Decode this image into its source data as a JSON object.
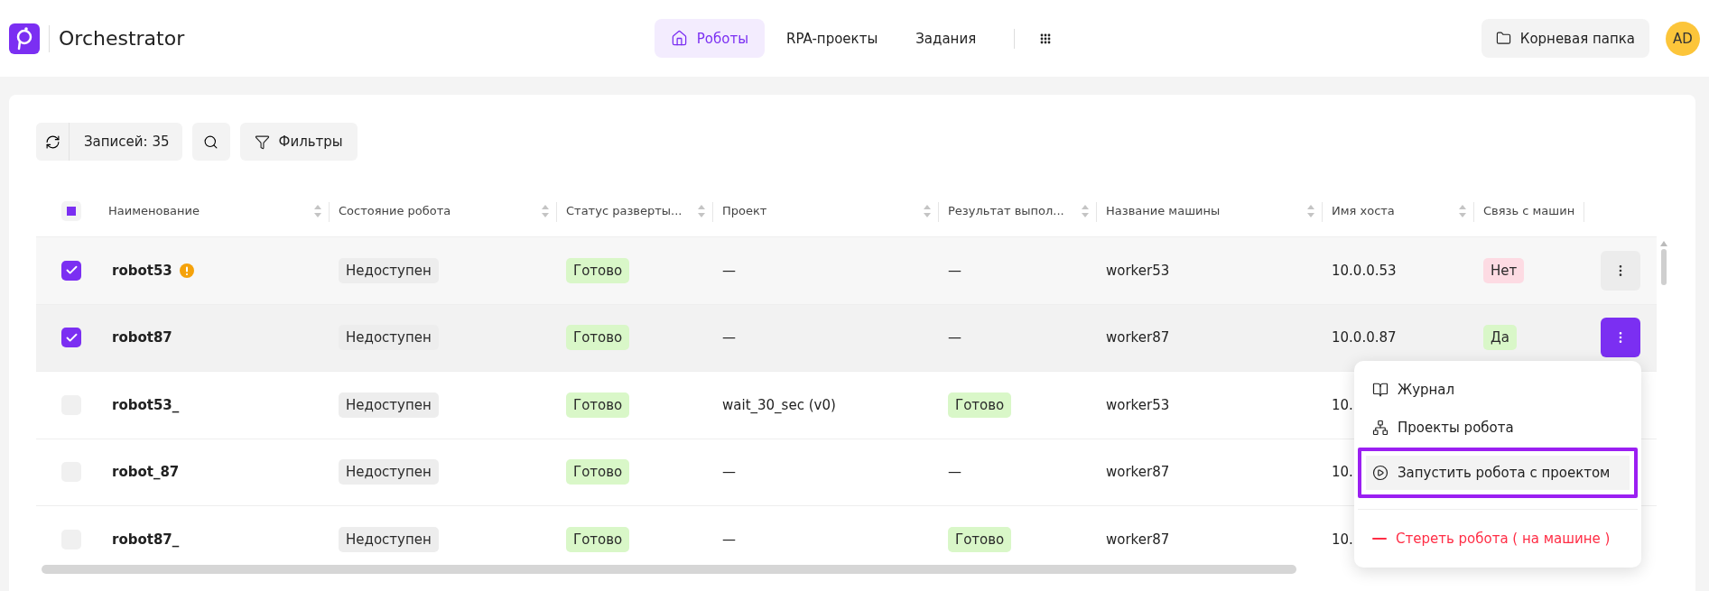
{
  "app": {
    "title": "Orchestrator"
  },
  "nav": [
    {
      "label": "Роботы",
      "selected": true
    },
    {
      "label": "RPA-проекты",
      "selected": false
    },
    {
      "label": "Задания",
      "selected": false
    }
  ],
  "folder_button": {
    "label": "Корневая папка"
  },
  "avatar": {
    "initials": "AD"
  },
  "toolbar": {
    "count": "Записей: 35",
    "filters": "Фильтры"
  },
  "table": {
    "select_all_partial": true,
    "columns": [
      {
        "label": "Наименование",
        "sortable": true
      },
      {
        "label": "Состояние робота",
        "sortable": true
      },
      {
        "label": "Статус разверты...",
        "sortable": true
      },
      {
        "label": "Проект",
        "sortable": true
      },
      {
        "label": "Результат выпол...",
        "sortable": true
      },
      {
        "label": "Название машины",
        "sortable": true
      },
      {
        "label": "Имя хоста",
        "sortable": true
      },
      {
        "label": "Связь с машин",
        "sortable": false
      }
    ],
    "rows": [
      {
        "checked": true,
        "menu_open": false,
        "has_actions": true,
        "name": "robot53",
        "warning": true,
        "state": {
          "text": "Недоступен",
          "color": "#ededed"
        },
        "status": {
          "text": "Готово",
          "color": "#d9f7c8"
        },
        "project": {
          "text": "—"
        },
        "result": {
          "text": "—"
        },
        "machine": {
          "text": "worker53"
        },
        "host": {
          "text": "10.0.0.53"
        },
        "link": {
          "text": "Нет",
          "color": "#fddbe3"
        }
      },
      {
        "checked": true,
        "menu_open": true,
        "has_actions": true,
        "name": "robot87",
        "warning": false,
        "state": {
          "text": "Недоступен",
          "color": "#ededed"
        },
        "status": {
          "text": "Готово",
          "color": "#d9f7c8"
        },
        "project": {
          "text": "—"
        },
        "result": {
          "text": "—"
        },
        "machine": {
          "text": "worker87"
        },
        "host": {
          "text": "10.0.0.87"
        },
        "link": {
          "text": "Да",
          "color": "#d9f7c8"
        }
      },
      {
        "checked": false,
        "menu_open": false,
        "has_actions": false,
        "name": "robot53_",
        "warning": false,
        "state": {
          "text": "Недоступен",
          "color": "#ededed"
        },
        "status": {
          "text": "Готово",
          "color": "#d9f7c8"
        },
        "project": {
          "text": "wait_30_sec (v0)"
        },
        "result": {
          "text": "Готово",
          "color": "#d9f7c8"
        },
        "machine": {
          "text": "worker53"
        },
        "host": {
          "text": "10."
        }
      },
      {
        "checked": false,
        "menu_open": false,
        "has_actions": false,
        "name": "robot_87",
        "warning": false,
        "state": {
          "text": "Недоступен",
          "color": "#ededed"
        },
        "status": {
          "text": "Готово",
          "color": "#d9f7c8"
        },
        "project": {
          "text": "—"
        },
        "result": {
          "text": "—"
        },
        "machine": {
          "text": "worker87"
        },
        "host": {
          "text": "10."
        }
      },
      {
        "checked": false,
        "menu_open": false,
        "has_actions": false,
        "name": "robot87_",
        "warning": false,
        "state": {
          "text": "Недоступен",
          "color": "#ededed"
        },
        "status": {
          "text": "Готово",
          "color": "#d9f7c8"
        },
        "project": {
          "text": "—"
        },
        "result": {
          "text": "Готово",
          "color": "#d9f7c8"
        },
        "machine": {
          "text": "worker87"
        },
        "host": {
          "text": "10."
        }
      }
    ]
  },
  "menu": [
    {
      "kind": "item",
      "label": "Журнал",
      "selected": false
    },
    {
      "kind": "item",
      "label": "Проекты робота",
      "selected": false
    },
    {
      "kind": "item",
      "label": "Запустить робота с проектом",
      "selected": true
    },
    {
      "kind": "danger",
      "label": "Стереть робота ( на машине )",
      "selected": false
    }
  ]
}
